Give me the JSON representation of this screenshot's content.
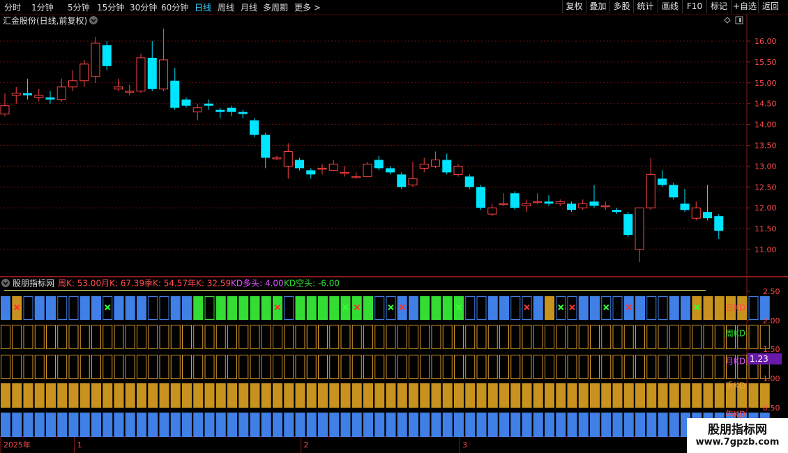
{
  "toolbar": {
    "periods": [
      "分时",
      "1分钟",
      "5分钟",
      "15分钟",
      "30分钟",
      "60分钟",
      "日线",
      "周线",
      "月线",
      "多周期",
      "更多 >"
    ],
    "active_period": "日线",
    "actions": [
      "复权",
      "叠加",
      "多股",
      "统计",
      "画线",
      "F10",
      "标记",
      "+自选",
      "返回"
    ]
  },
  "main_chart": {
    "stock_title": "汇金股份(日线,前复权)",
    "price_ticks": [
      "16.00",
      "15.50",
      "15.00",
      "14.50",
      "14.00",
      "13.50",
      "13.00",
      "12.50",
      "12.00",
      "11.50",
      "11.00"
    ],
    "candles": [
      [
        14.25,
        14.45,
        14.75,
        14.2
      ],
      [
        14.7,
        14.75,
        14.9,
        14.5
      ],
      [
        14.75,
        14.7,
        15.1,
        14.6
      ],
      [
        14.65,
        14.7,
        14.85,
        14.55
      ],
      [
        14.65,
        14.6,
        14.8,
        14.5
      ],
      [
        14.6,
        14.9,
        15.1,
        14.55
      ],
      [
        14.9,
        15.05,
        15.3,
        14.8
      ],
      [
        15.05,
        15.45,
        15.55,
        14.9
      ],
      [
        15.15,
        15.95,
        16.1,
        15.0
      ],
      [
        15.9,
        15.4,
        16.0,
        15.3
      ],
      [
        14.85,
        14.9,
        15.1,
        14.8
      ],
      [
        14.8,
        14.8,
        14.95,
        14.7
      ],
      [
        14.8,
        15.6,
        15.7,
        14.75
      ],
      [
        15.6,
        14.85,
        16.0,
        14.8
      ],
      [
        14.85,
        15.55,
        16.3,
        14.8
      ],
      [
        15.05,
        14.4,
        15.35,
        14.35
      ],
      [
        14.6,
        14.45,
        14.65,
        14.4
      ],
      [
        14.3,
        14.4,
        14.5,
        14.1
      ],
      [
        14.5,
        14.45,
        14.6,
        14.35
      ],
      [
        14.35,
        14.3,
        14.4,
        14.15
      ],
      [
        14.4,
        14.3,
        14.45,
        14.2
      ],
      [
        14.3,
        14.25,
        14.35,
        14.15
      ],
      [
        14.1,
        13.75,
        14.15,
        13.7
      ],
      [
        13.75,
        13.2,
        13.8,
        12.95
      ],
      [
        13.2,
        13.2,
        13.25,
        13.15
      ],
      [
        13.0,
        13.35,
        13.55,
        12.7
      ],
      [
        13.15,
        12.95,
        13.2,
        12.9
      ],
      [
        12.9,
        12.8,
        12.95,
        12.7
      ],
      [
        12.95,
        12.95,
        13.05,
        12.8
      ],
      [
        12.9,
        13.05,
        13.15,
        12.9
      ],
      [
        12.85,
        12.85,
        13.0,
        12.75
      ],
      [
        12.75,
        12.75,
        12.85,
        12.7
      ],
      [
        12.75,
        13.05,
        13.1,
        12.75
      ],
      [
        13.15,
        12.95,
        13.25,
        12.9
      ],
      [
        12.95,
        12.85,
        13.0,
        12.8
      ],
      [
        12.8,
        12.5,
        12.85,
        12.45
      ],
      [
        12.55,
        12.7,
        13.1,
        12.5
      ],
      [
        12.95,
        13.05,
        13.2,
        12.85
      ],
      [
        13.0,
        13.15,
        13.35,
        12.95
      ],
      [
        13.15,
        12.85,
        13.3,
        12.8
      ],
      [
        12.8,
        13.0,
        13.05,
        12.75
      ],
      [
        12.75,
        12.5,
        12.8,
        12.45
      ],
      [
        12.5,
        12.0,
        12.55,
        11.95
      ],
      [
        11.85,
        12.0,
        12.1,
        11.8
      ],
      [
        12.1,
        12.1,
        12.35,
        12.05
      ],
      [
        12.35,
        12.0,
        12.4,
        11.95
      ],
      [
        12.05,
        12.1,
        12.2,
        11.9
      ],
      [
        12.15,
        12.15,
        12.35,
        12.1
      ],
      [
        12.15,
        12.1,
        12.3,
        12.05
      ],
      [
        12.1,
        12.15,
        12.2,
        12.05
      ],
      [
        12.1,
        11.95,
        12.15,
        11.9
      ],
      [
        12.0,
        12.1,
        12.2,
        11.95
      ],
      [
        12.15,
        12.05,
        12.55,
        12.0
      ],
      [
        12.05,
        12.05,
        12.15,
        11.95
      ],
      [
        11.95,
        11.9,
        12.0,
        11.85
      ],
      [
        11.85,
        11.35,
        11.9,
        11.3
      ],
      [
        11.0,
        12.0,
        12.0,
        10.7
      ],
      [
        12.0,
        12.8,
        13.2,
        11.95
      ],
      [
        12.7,
        12.55,
        12.9,
        12.5
      ],
      [
        12.55,
        12.25,
        12.6,
        12.2
      ],
      [
        12.1,
        11.95,
        12.45,
        11.9
      ],
      [
        11.75,
        12.0,
        12.15,
        11.7
      ],
      [
        11.9,
        11.75,
        12.55,
        11.7
      ],
      [
        11.8,
        11.45,
        11.85,
        11.25
      ]
    ],
    "colors": {
      "up": "#ff4444",
      "down": "#00e5ff"
    }
  },
  "indicator": {
    "name": "股朋指标网",
    "readouts": [
      {
        "text": "周K: 53.00",
        "color": "#ff4b4b"
      },
      {
        "text": "月K: 67.39",
        "color": "#ff4b4b"
      },
      {
        "text": "季K: 54.57",
        "color": "#ff4b4b"
      },
      {
        "text": "年K: 32.59",
        "color": "#ff4b4b"
      },
      {
        "text": "KD多头: 4.00",
        "color": "#e052ff"
      },
      {
        "text": "KD空头: -6.00",
        "color": "#33dd33"
      }
    ],
    "row_labels": [
      {
        "text": "日KD",
        "color": "#ff4b4b"
      },
      {
        "text": "周KD",
        "color": "#33dd33"
      },
      {
        "text": "月KD",
        "color": "#e052ff"
      },
      {
        "text": "季KD",
        "color": "#e8a23a"
      },
      {
        "text": "年KD",
        "color": "#ff4b4b"
      }
    ],
    "axis_ticks": [
      "2.50",
      "2.00",
      "1.50",
      "1.00",
      "0.50"
    ],
    "current_value": "1.23",
    "daily_row": "BOBBBBBBBBXBBBBBBGgGGGGGGBGGGGGGGBBBBGGGGBBBBBBBOBBBBBBBBBBBBOOOOOBB",
    "marks": [
      [
        1,
        "r"
      ],
      [
        9,
        "g"
      ],
      [
        24,
        "r"
      ],
      [
        30,
        "g"
      ],
      [
        31,
        "r"
      ],
      [
        34,
        "g"
      ],
      [
        35,
        "r"
      ],
      [
        40,
        "g"
      ],
      [
        46,
        "r"
      ],
      [
        49,
        "g"
      ],
      [
        50,
        "r"
      ],
      [
        53,
        "g"
      ],
      [
        55,
        "r"
      ],
      [
        61,
        "g"
      ]
    ]
  },
  "date_axis": {
    "labels": [
      {
        "text": "2025年",
        "pos": 0
      },
      {
        "text": "1",
        "pos": 6.5
      },
      {
        "text": "2",
        "pos": 26.5
      },
      {
        "text": "3",
        "pos": 40.5
      }
    ]
  },
  "watermark": {
    "title": "股朋指标网",
    "url": "www.7gpzb.com"
  }
}
